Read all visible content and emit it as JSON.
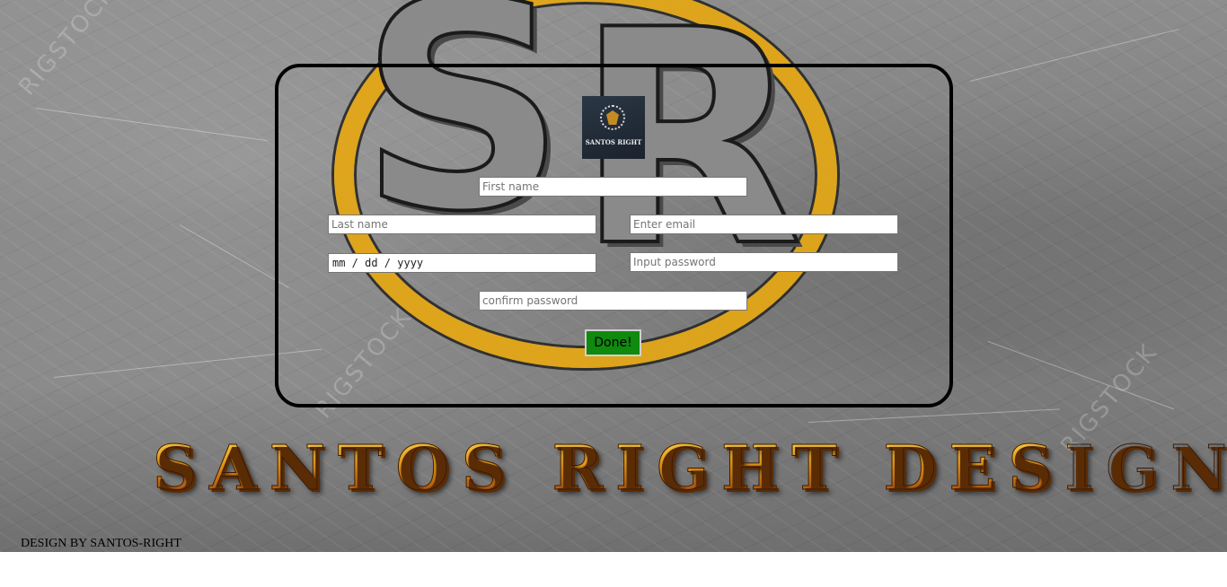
{
  "logo": {
    "text": "SANTOS RIGHT"
  },
  "form": {
    "first_name": {
      "placeholder": "First name"
    },
    "last_name": {
      "placeholder": "Last name"
    },
    "email": {
      "placeholder": "Enter email"
    },
    "birth_date": {
      "value": "mm / dd / yyyy"
    },
    "password": {
      "placeholder": "Input password"
    },
    "confirm_password": {
      "placeholder": "confirm password"
    },
    "submit_label": "Done!"
  },
  "brand": {
    "title": "SANTOS RIGHT DESIGN"
  },
  "footer": {
    "text": "DESIGN BY SANTOS-RIGHT"
  },
  "colors": {
    "submit_button": "#0f8a0f",
    "brand_gold": "#e39a1a",
    "panel_border": "#000000",
    "ring_gold": "#e2a617"
  }
}
